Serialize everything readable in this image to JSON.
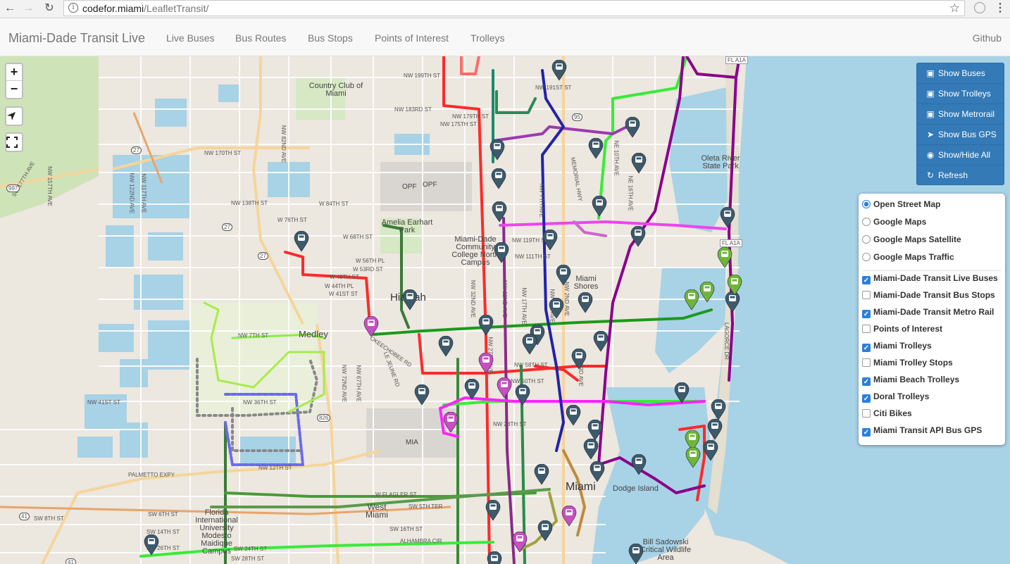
{
  "browser": {
    "url_host": "codefor.miami",
    "url_path": "/LeafletTransit/"
  },
  "navbar": {
    "brand": "Miami-Dade Transit Live",
    "links": [
      "Live Buses",
      "Bus Routes",
      "Bus Stops",
      "Points of Interest",
      "Trolleys"
    ],
    "right_link": "Github"
  },
  "map_controls": {
    "zoom_in": "+",
    "zoom_out": "−"
  },
  "button_panel": [
    {
      "label": "Show Buses",
      "icon": "bus-icon"
    },
    {
      "label": "Show Trolleys",
      "icon": "trolley-icon"
    },
    {
      "label": "Show Metrorail",
      "icon": "train-icon"
    },
    {
      "label": "Show Bus GPS",
      "icon": "location-arrow-icon"
    },
    {
      "label": "Show/Hide All",
      "icon": "eye-icon"
    },
    {
      "label": "Refresh",
      "icon": "refresh-icon"
    }
  ],
  "base_layers": [
    {
      "label": "Open Street Map",
      "selected": true
    },
    {
      "label": "Google Maps",
      "selected": false
    },
    {
      "label": "Google Maps Satellite",
      "selected": false
    },
    {
      "label": "Google Maps Traffic",
      "selected": false
    }
  ],
  "overlays": [
    {
      "label": "Miami-Dade Transit Live Buses",
      "checked": true
    },
    {
      "label": "Miami-Dade Transit Bus Stops",
      "checked": false
    },
    {
      "label": "Miami-Dade Transit Metro Rail",
      "checked": true
    },
    {
      "label": "Points of Interest",
      "checked": false
    },
    {
      "label": "Miami Trolleys",
      "checked": true
    },
    {
      "label": "Miami Trolley Stops",
      "checked": false
    },
    {
      "label": "Miami Beach Trolleys",
      "checked": true
    },
    {
      "label": "Doral Trolleys",
      "checked": true
    },
    {
      "label": "Citi Bikes",
      "checked": false
    },
    {
      "label": "Miami Transit API Bus GPS",
      "checked": true
    }
  ],
  "map_labels": {
    "cities": [
      "Hialeah",
      "Medley",
      "Miami"
    ],
    "places": [
      "Country Club of Miami",
      "Amelia Earhart Park",
      "Miami-Dade Community College North Campus",
      "Miami Shores",
      "Oleta River State Park",
      "West Miami",
      "Florida International University Modesto Maidique Campus",
      "Bill Sadowski Critical Wildlife Area",
      "Dodge Island",
      "OPF",
      "OPF",
      "MIA"
    ],
    "streets": [
      "NW 199TH ST",
      "NW 183RD ST",
      "NW 179TH ST",
      "NW 175TH ST",
      "NW 170TH ST",
      "NW 138TH ST",
      "W 84TH ST",
      "W 76TH ST",
      "W 68TH ST",
      "W 56TH PL",
      "W 53RD ST",
      "W 49TH ST",
      "W 44TH PL",
      "W 41ST ST",
      "NW 41ST ST",
      "NW 36TH ST",
      "NW 12TH ST",
      "NW 7TH ST",
      "W FLAGLER ST",
      "SW 8TH ST",
      "SW 5TH TER",
      "SW 16TH ST",
      "SW 24TH ST",
      "SW 28TH ST",
      "ALHAMBRA CIR",
      "SW 6TH ST",
      "SW 14TH ST",
      "SW 26TH ST",
      "NW 191ST ST",
      "NW 119TH ST",
      "NW 111TH ST",
      "NW 58TH ST",
      "NW 50TH ST",
      "NW 28TH ST",
      "PALMETTO EXPY",
      "NW 117TH AVE",
      "NW 122ND AVE",
      "NW 157TH AVE",
      "SW 177TH AVE",
      "NW 82ND AVE",
      "NW 72ND AVE",
      "NW 67TH AVE",
      "NE 10TH AVE",
      "NE 16TH AVE",
      "MEMORIAL HWY",
      "LE JEUNE RD",
      "OKEECHOBEE RD",
      "LAGORCE DR",
      "FL A1A",
      "FL A1A",
      "NW 2ND AVE",
      "NW 22ND AVE",
      "NW 32ND AVE",
      "NW 27TH AVE",
      "NW 17TH AVE",
      "NW 7TH AVE",
      "NW 5TH AVE",
      "NW 3RD AVE"
    ],
    "shields": [
      "27",
      "27",
      "27",
      "997",
      "95",
      "826",
      "41",
      "41"
    ]
  }
}
